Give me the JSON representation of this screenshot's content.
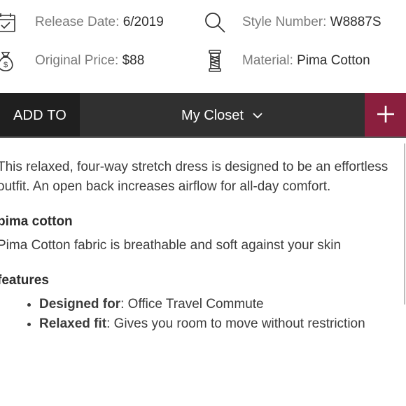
{
  "info": {
    "release": {
      "label": "Release Date:",
      "value": "6/2019",
      "icon": "calendar-icon"
    },
    "style": {
      "label": "Style Number:",
      "value": "W8887S",
      "icon": "search-icon"
    },
    "price": {
      "label": "Original Price:",
      "value": "$88",
      "icon": "money-bag-icon"
    },
    "material": {
      "label": "Material:",
      "value": "Pima Cotton",
      "icon": "thread-spool-icon"
    }
  },
  "action_bar": {
    "add_to_label": "ADD TO",
    "closet_select": "My Closet",
    "plus_label": "+",
    "colors": {
      "bar": "#303030",
      "add_to_bg": "#1f1f1f",
      "plus_bg": "#8b1f3e"
    }
  },
  "description": {
    "intro_line1": "This relaxed, four-way stretch dress is designed to be an effortless",
    "intro_line2": "outfit. An open back increases airflow for all-day comfort.",
    "section1_heading": "pima cotton",
    "section1_body": "Pima Cotton fabric is breathable and soft against your skin",
    "section2_heading": "features",
    "features": [
      {
        "term": "Designed for",
        "text": ": Office Travel Commute"
      },
      {
        "term": "Relaxed fit",
        "text": ": Gives you room to move without restriction"
      }
    ]
  }
}
